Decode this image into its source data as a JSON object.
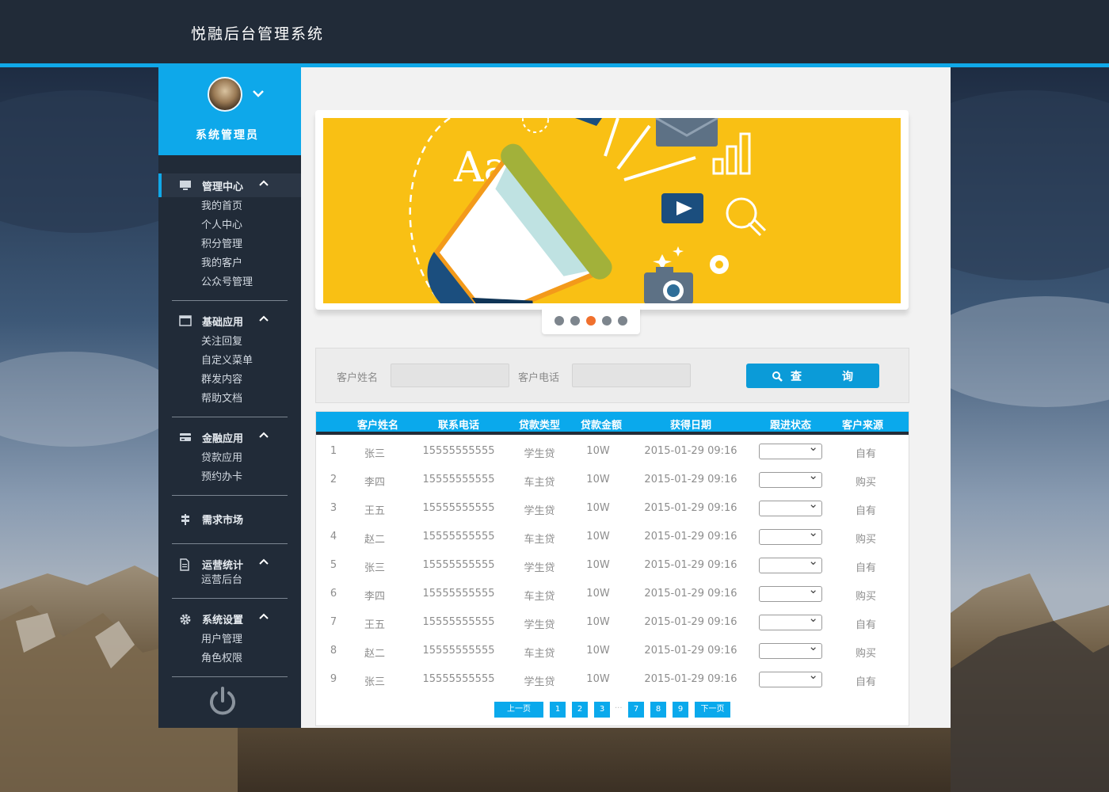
{
  "app": {
    "title": "悦融后台管理系统"
  },
  "profile": {
    "name": "系统管理员"
  },
  "sidebar": {
    "groups": [
      {
        "label": "管理中心",
        "icon": "monitor-icon",
        "items": [
          "我的首页",
          "个人中心",
          "积分管理",
          "我的客户",
          "公众号管理"
        ]
      },
      {
        "label": "基础应用",
        "icon": "window-icon",
        "items": [
          "关注回复",
          "自定义菜单",
          "群发内容",
          "帮助文档"
        ]
      },
      {
        "label": "金融应用",
        "icon": "card-icon",
        "items": [
          "贷款应用",
          "预约办卡"
        ]
      },
      {
        "label": "需求市场",
        "icon": "signpost-icon",
        "items": []
      },
      {
        "label": "运营统计",
        "icon": "document-icon",
        "items": [
          "运营后台"
        ]
      },
      {
        "label": "系统设置",
        "icon": "gear-icon",
        "items": [
          "用户管理",
          "角色权限"
        ]
      }
    ]
  },
  "banner": {
    "text": "Aa",
    "dots": 5,
    "active_dot": 3
  },
  "search": {
    "name_label": "客户姓名",
    "phone_label": "客户电话",
    "button_label": "查询",
    "button_left": "查",
    "button_right": "询"
  },
  "table": {
    "headers": [
      "客户姓名",
      "联系电话",
      "贷款类型",
      "贷款金额",
      "获得日期",
      "跟进状态",
      "客户来源"
    ],
    "rows": [
      [
        "1",
        "张三",
        "15555555555",
        "学生贷",
        "10W",
        "2015-01-29 09:16",
        "自有"
      ],
      [
        "2",
        "李四",
        "15555555555",
        "车主贷",
        "10W",
        "2015-01-29 09:16",
        "购买"
      ],
      [
        "3",
        "王五",
        "15555555555",
        "学生贷",
        "10W",
        "2015-01-29 09:16",
        "自有"
      ],
      [
        "4",
        "赵二",
        "15555555555",
        "车主贷",
        "10W",
        "2015-01-29 09:16",
        "购买"
      ],
      [
        "5",
        "张三",
        "15555555555",
        "学生贷",
        "10W",
        "2015-01-29 09:16",
        "自有"
      ],
      [
        "6",
        "李四",
        "15555555555",
        "车主贷",
        "10W",
        "2015-01-29 09:16",
        "购买"
      ],
      [
        "7",
        "王五",
        "15555555555",
        "学生贷",
        "10W",
        "2015-01-29 09:16",
        "自有"
      ],
      [
        "8",
        "赵二",
        "15555555555",
        "车主贷",
        "10W",
        "2015-01-29 09:16",
        "购买"
      ],
      [
        "9",
        "张三",
        "15555555555",
        "学生贷",
        "10W",
        "2015-01-29 09:16",
        "自有"
      ]
    ]
  },
  "pager": {
    "prev": "上一页",
    "next": "下一页",
    "pages": [
      "1",
      "2",
      "3",
      "7",
      "8",
      "9"
    ],
    "ellipsis": "..."
  },
  "colors": {
    "accent": "#0aa9ec",
    "banner": "#f9c014",
    "sidebar": "#212b38",
    "active_dot": "#f0702d"
  }
}
